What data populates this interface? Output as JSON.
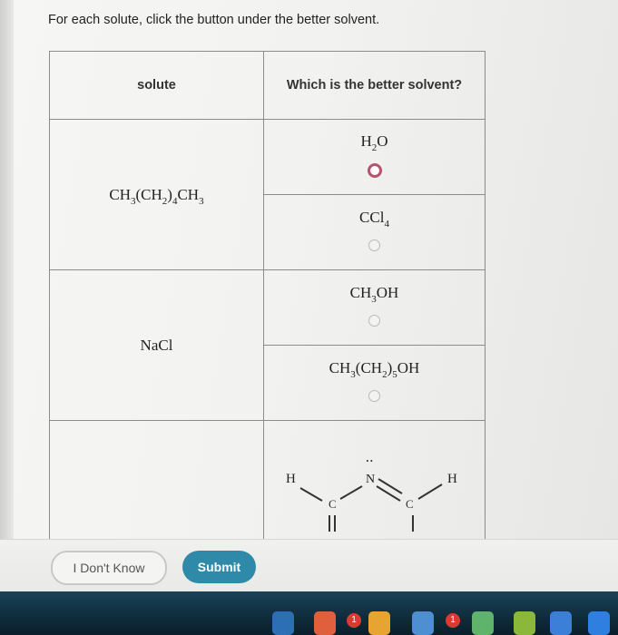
{
  "instructions": "For each solute, click the button under the better solvent.",
  "table": {
    "col_solute": "solute",
    "col_solvent": "Which is the better solvent?",
    "rows": [
      {
        "solute": {
          "parts": [
            "CH",
            "3",
            "(CH",
            "2",
            ")",
            "4",
            "CH",
            "3"
          ]
        },
        "options": [
          {
            "parts": [
              "H",
              "2",
              "O"
            ],
            "selected": true
          },
          {
            "parts": [
              "CCl",
              "4"
            ],
            "selected": false
          }
        ]
      },
      {
        "solute": {
          "parts": [
            "NaCl"
          ]
        },
        "options": [
          {
            "parts": [
              "CH",
              "3",
              "OH"
            ],
            "selected": false
          },
          {
            "parts": [
              "CH",
              "3",
              "(CH",
              "2",
              ")",
              "5",
              "OH"
            ],
            "selected": false
          }
        ]
      }
    ],
    "structure": {
      "left_h": "H",
      "carbon1": "C",
      "nitrogen": "N",
      "carbon2": "C",
      "right_h": "H",
      "lone_pair": ":"
    }
  },
  "buttons": {
    "dont_know": "I Don't Know",
    "submit": "Submit"
  },
  "dock": {
    "badge_1": "1",
    "badge_2": "1",
    "accent": "#2e8aa8",
    "selected_radio_color": "#b7546b"
  }
}
